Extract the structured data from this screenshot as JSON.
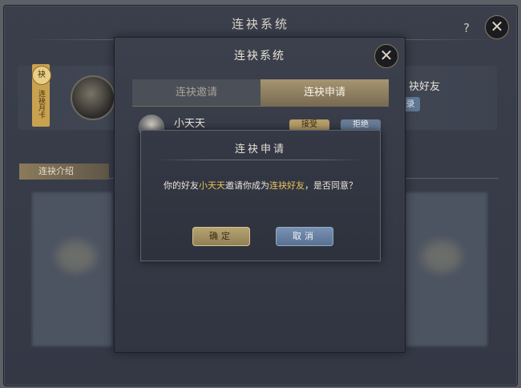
{
  "back_window": {
    "title": "连袂系统",
    "help_label": "?",
    "close_label": "✕",
    "ribbon_badge": "袂",
    "ribbon_text": "连袂月卡",
    "right_label": "袂好友",
    "right_button": "录",
    "section_tab": "连袂介绍"
  },
  "mid_window": {
    "title": "连袂系统",
    "close_label": "✕",
    "tabs": [
      {
        "label": "连袂邀请",
        "active": false
      },
      {
        "label": "连袂申请",
        "active": true
      }
    ],
    "request": {
      "name": "小天天",
      "accept_label": "接受",
      "reject_label": "拒绝"
    }
  },
  "dialog": {
    "title": "连袂申请",
    "message_prefix": "你的好友",
    "message_friend": "小天天",
    "message_middle": "邀请你成为",
    "message_relation": "连袂好友",
    "message_suffix": "，是否同意？",
    "confirm_label": "确定",
    "cancel_label": "取消"
  },
  "colors": {
    "highlight": "#e8c35a",
    "gold_button": "#b8a573",
    "blue_button": "#7a93b5",
    "panel": "#353945"
  }
}
